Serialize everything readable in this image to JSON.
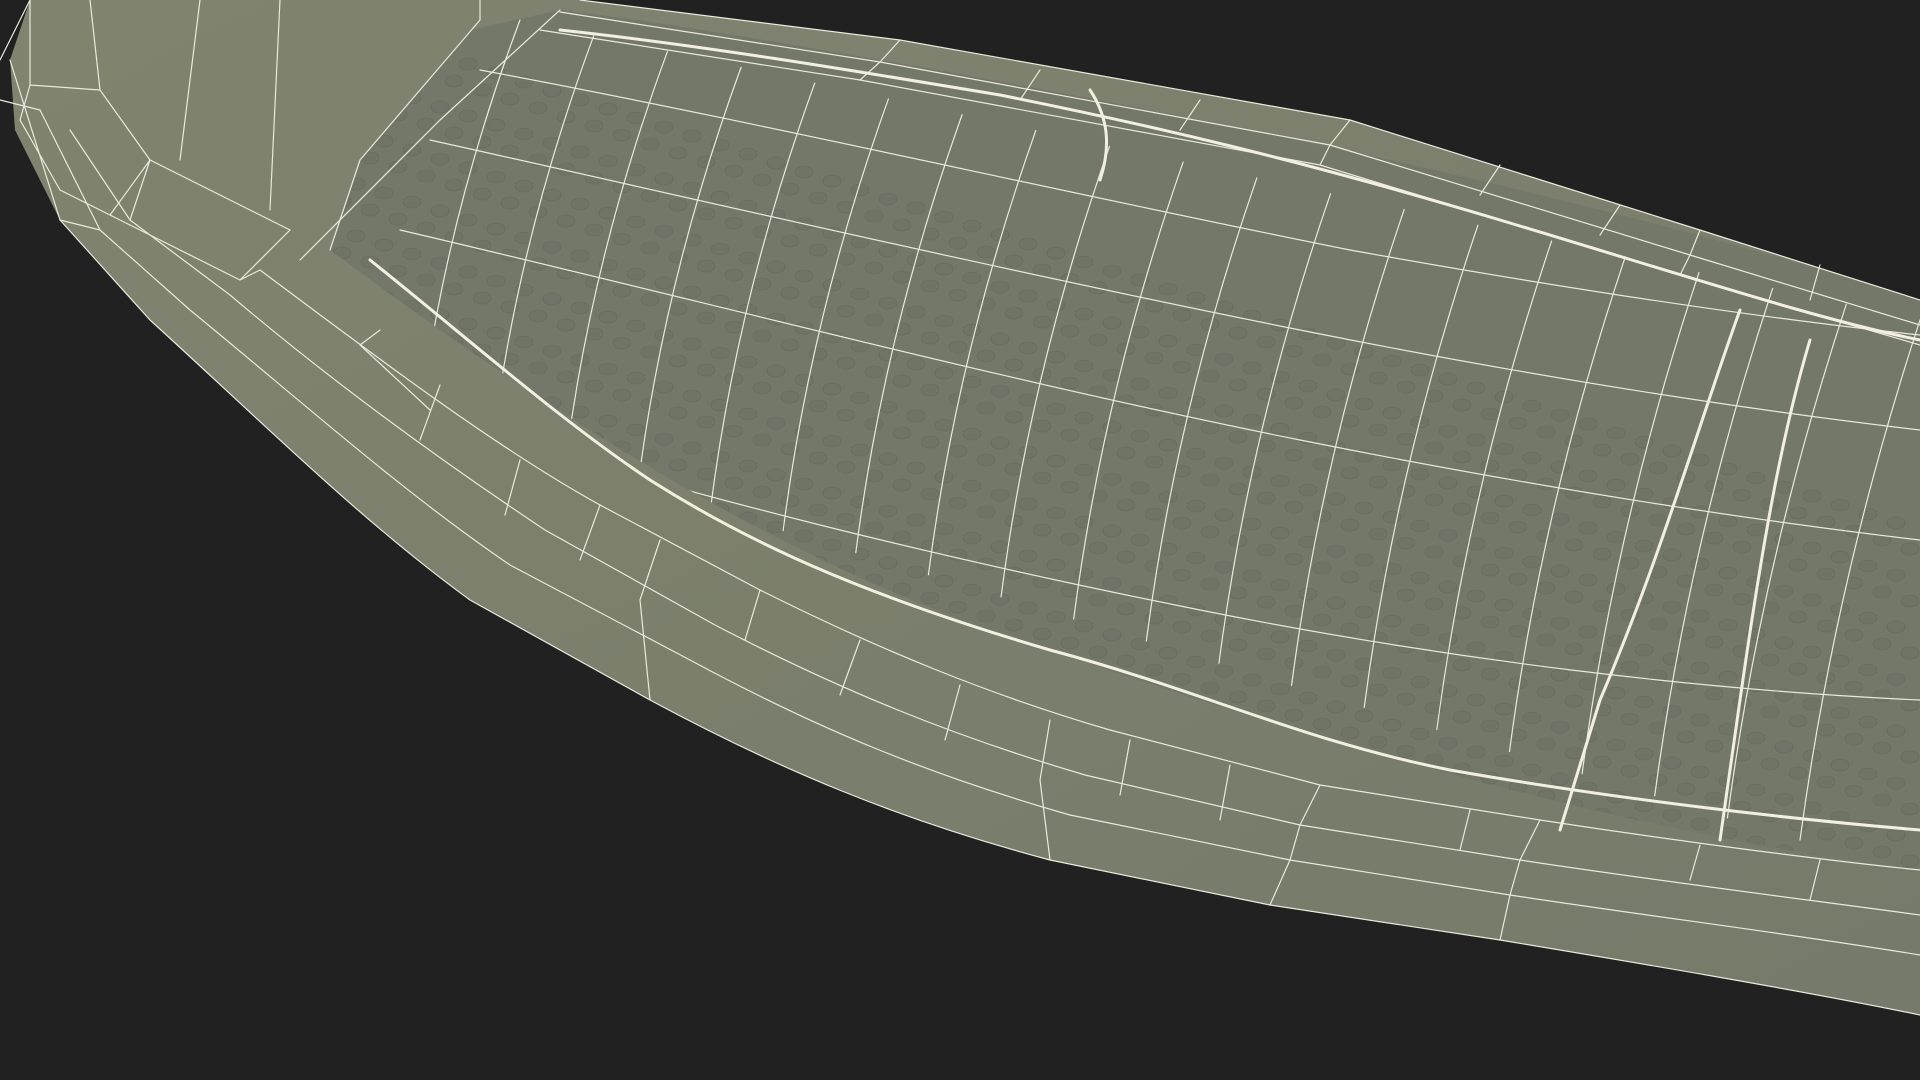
{
  "scene": {
    "type": "3d-wireframe-render",
    "background_color": "#212121",
    "mesh_fill_color": "#7c8070",
    "inner_panel_color": "#747868",
    "wire_color": "#e9e9dc",
    "seam_color": "#f1efe0",
    "dimple_color": "#6f7466"
  }
}
